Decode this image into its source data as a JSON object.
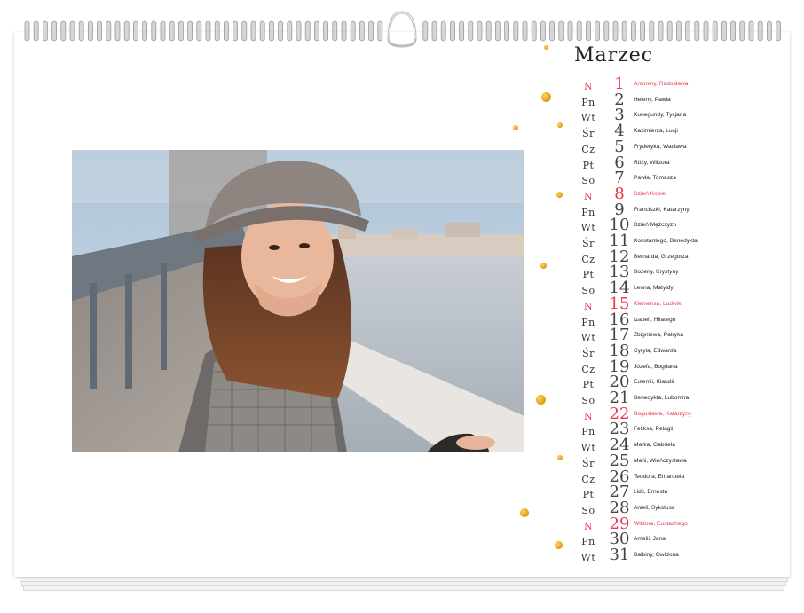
{
  "calendar": {
    "month": "Marzec",
    "days": [
      {
        "dow": "N",
        "day": "1",
        "names": "Antoniny, Radosława",
        "holiday": true
      },
      {
        "dow": "Pn",
        "day": "2",
        "names": "Heleny, Pawła",
        "holiday": false
      },
      {
        "dow": "Wt",
        "day": "3",
        "names": "Kunegundy, Tycjana",
        "holiday": false
      },
      {
        "dow": "Śr",
        "day": "4",
        "names": "Kazimierza, Łucji",
        "holiday": false
      },
      {
        "dow": "Cz",
        "day": "5",
        "names": "Fryderyka, Wacława",
        "holiday": false
      },
      {
        "dow": "Pt",
        "day": "6",
        "names": "Róży, Wiktora",
        "holiday": false
      },
      {
        "dow": "So",
        "day": "7",
        "names": "Pawła, Tomasza",
        "holiday": false
      },
      {
        "dow": "N",
        "day": "8",
        "names": "Dzień Kobiet",
        "holiday": true
      },
      {
        "dow": "Pn",
        "day": "9",
        "names": "Franciszki, Katarzyny",
        "holiday": false
      },
      {
        "dow": "Wt",
        "day": "10",
        "names": "Dzień Mężczyzn",
        "holiday": false
      },
      {
        "dow": "Śr",
        "day": "11",
        "names": "Konstantego, Benedykta",
        "holiday": false
      },
      {
        "dow": "Cz",
        "day": "12",
        "names": "Bernarda, Grzegorza",
        "holiday": false
      },
      {
        "dow": "Pt",
        "day": "13",
        "names": "Bożeny, Krystyny",
        "holiday": false
      },
      {
        "dow": "So",
        "day": "14",
        "names": "Leona, Matyldy",
        "holiday": false
      },
      {
        "dow": "N",
        "day": "15",
        "names": "Klemensa, Ludwiki",
        "holiday": true
      },
      {
        "dow": "Pn",
        "day": "16",
        "names": "Izabeli, Hilarego",
        "holiday": false
      },
      {
        "dow": "Wt",
        "day": "17",
        "names": "Zbigniewa, Patryka",
        "holiday": false
      },
      {
        "dow": "Śr",
        "day": "18",
        "names": "Cyryla, Edwarda",
        "holiday": false
      },
      {
        "dow": "Cz",
        "day": "19",
        "names": "Józefa, Bogdana",
        "holiday": false
      },
      {
        "dow": "Pt",
        "day": "20",
        "names": "Eufemii, Klaudii",
        "holiday": false
      },
      {
        "dow": "So",
        "day": "21",
        "names": "Benedykta, Lubomira",
        "holiday": false
      },
      {
        "dow": "N",
        "day": "22",
        "names": "Bogusława, Katarzyny",
        "holiday": true
      },
      {
        "dow": "Pn",
        "day": "23",
        "names": "Feliksa, Pelagii",
        "holiday": false
      },
      {
        "dow": "Wt",
        "day": "24",
        "names": "Marka, Gabriela",
        "holiday": false
      },
      {
        "dow": "Śr",
        "day": "25",
        "names": "Marii, Wieńczysława",
        "holiday": false
      },
      {
        "dow": "Cz",
        "day": "26",
        "names": "Teodora, Emanuela",
        "holiday": false
      },
      {
        "dow": "Pt",
        "day": "27",
        "names": "Lidii, Ernesta",
        "holiday": false
      },
      {
        "dow": "So",
        "day": "28",
        "names": "Anieli, Sykstusa",
        "holiday": false
      },
      {
        "dow": "N",
        "day": "29",
        "names": "Wiktora, Eustachego",
        "holiday": true
      },
      {
        "dow": "Pn",
        "day": "30",
        "names": "Amelii, Jana",
        "holiday": false
      },
      {
        "dow": "Wt",
        "day": "31",
        "names": "Balbiny, Gwidona",
        "holiday": false
      }
    ]
  },
  "colors": {
    "holiday": "#e8374e",
    "text": "#222222",
    "gold": "#e6a115"
  }
}
